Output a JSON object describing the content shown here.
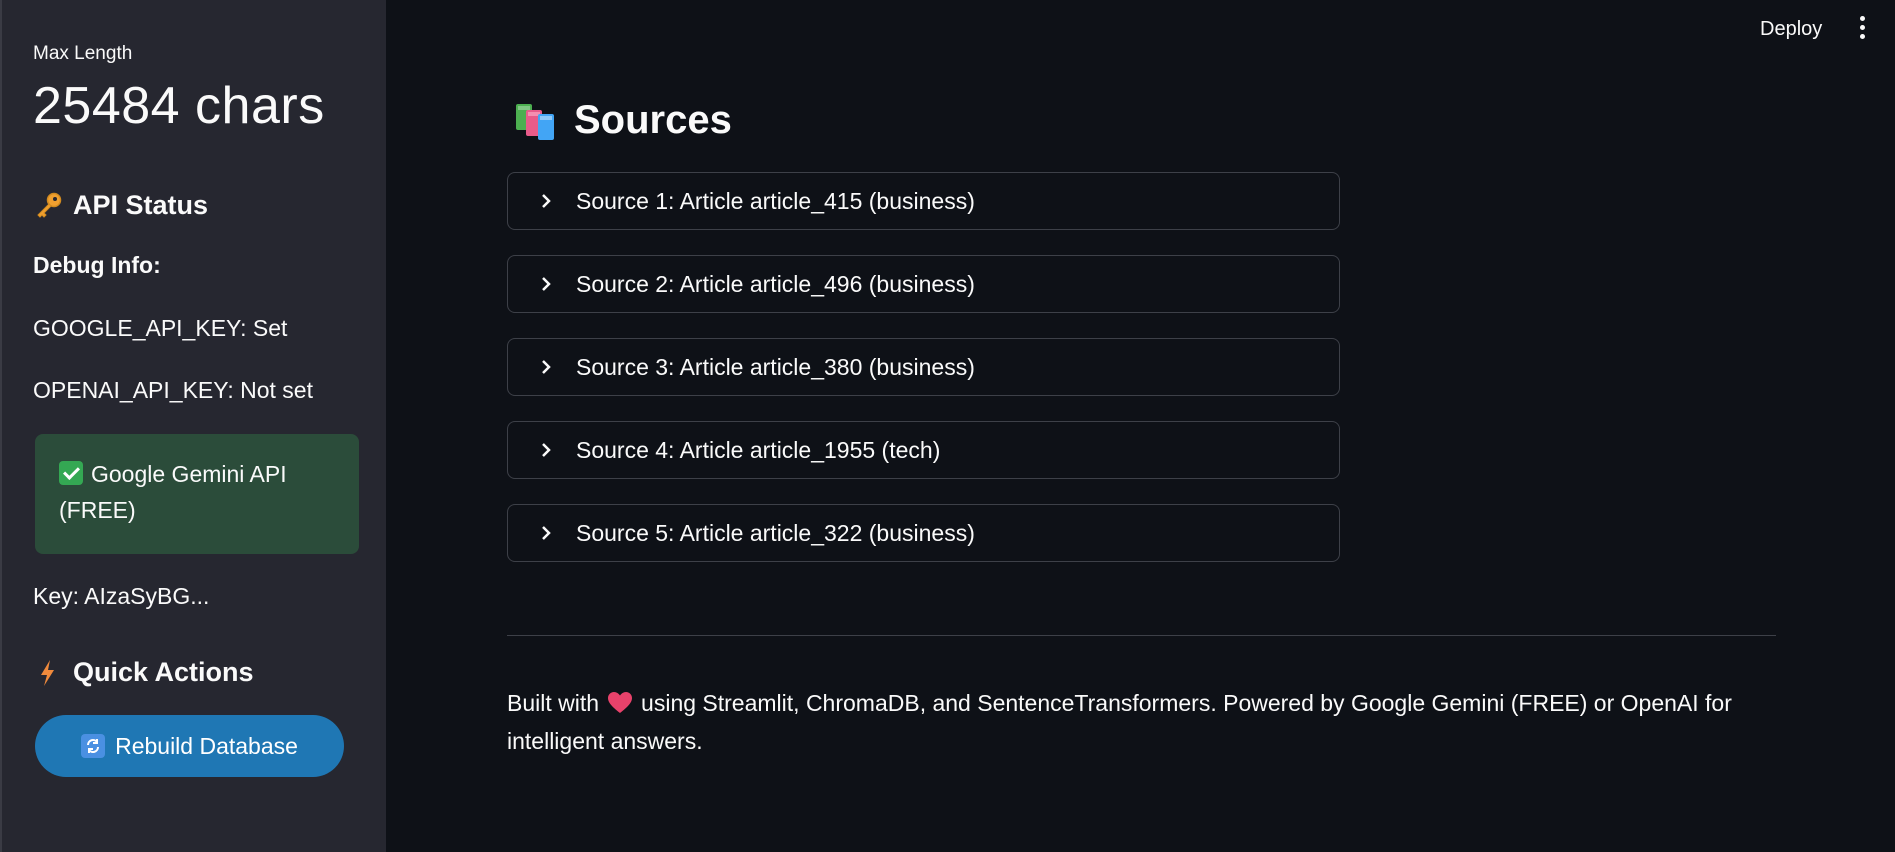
{
  "sidebar": {
    "metric_label": "Max Length",
    "metric_value": "25484 chars",
    "api_status_title": "API Status",
    "debug_info": "Debug Info:",
    "google_key_status": "GOOGLE_API_KEY: Set",
    "openai_key_status": "OPENAI_API_KEY: Not set",
    "success_line1": "Google Gemini API",
    "success_line2": "(FREE)",
    "key_preview": "Key: AIzaSyBG...",
    "quick_actions_title": "Quick Actions",
    "rebuild_label": "Rebuild Database"
  },
  "header": {
    "deploy_label": "Deploy"
  },
  "main": {
    "title": "Sources",
    "sources": [
      "Source 1: Article article_415 (business)",
      "Source 2: Article article_496 (business)",
      "Source 3: Article article_380 (business)",
      "Source 4: Article article_1955 (tech)",
      "Source 5: Article article_322 (business)"
    ],
    "footer_before": "Built with",
    "footer_after": "using Streamlit, ChromaDB, and SentenceTransformers. Powered by Google Gemini (FREE) or OpenAI for intelligent answers."
  },
  "icons": [
    "key-icon",
    "lightning-icon",
    "check-icon",
    "refresh-icon",
    "books-icon",
    "chevron-right-icon",
    "heart-icon",
    "kebab-menu-icon"
  ],
  "colors": {
    "background": "#0e1117",
    "sidebar": "#262730",
    "success": "#2b4c3a",
    "primary_button": "#1f77b4",
    "border": "#3d4048"
  }
}
